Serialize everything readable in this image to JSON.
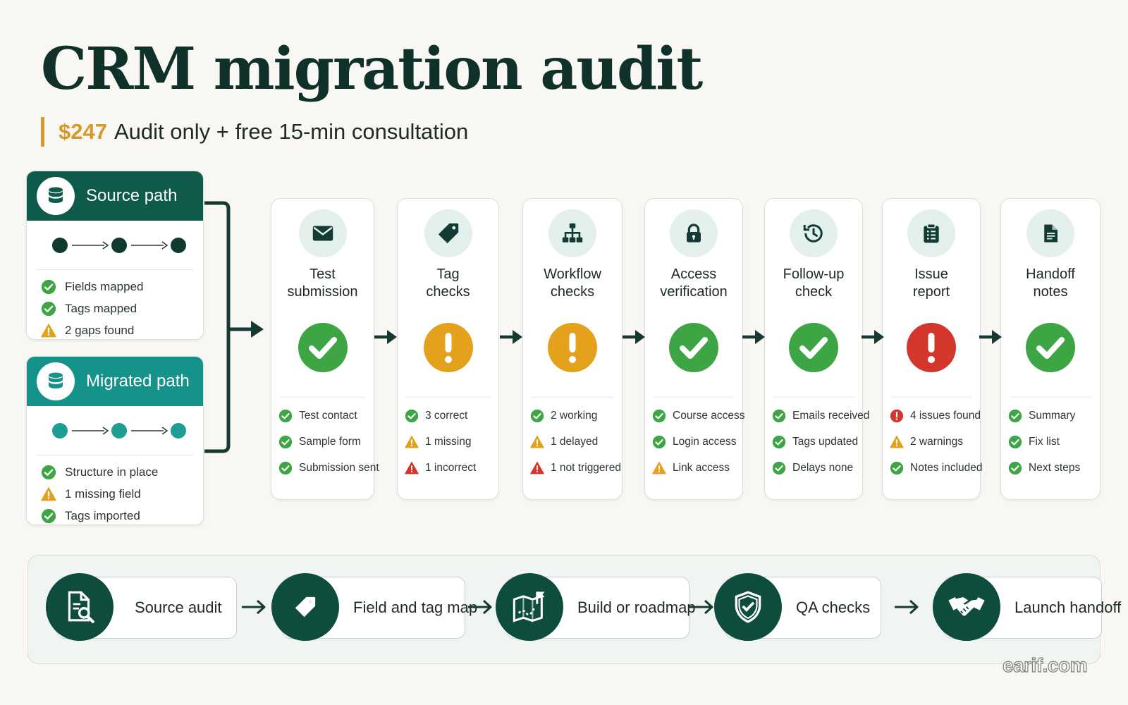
{
  "title": "CRM migration audit",
  "subtitle": {
    "price": "$247",
    "text": "Audit only + free 15-min consultation"
  },
  "colors": {
    "dark_green": "#0e4c3d",
    "teal": "#15928a",
    "gold": "#d49b2a",
    "ok_green": "#3da544",
    "warn_amber": "#e3a11c",
    "error_red": "#d3372b"
  },
  "panels": [
    {
      "title": "Source path",
      "icon": "database-icon",
      "color": "#0e5b4b",
      "node_color": "#103a30",
      "items": [
        {
          "status": "ok",
          "text": "Fields mapped"
        },
        {
          "status": "ok",
          "text": "Tags mapped"
        },
        {
          "status": "warn",
          "text": "2 gaps found"
        }
      ]
    },
    {
      "title": "Migrated path",
      "icon": "database-icon",
      "color": "#15928a",
      "node_color": "#1e9d94",
      "items": [
        {
          "status": "ok",
          "text": "Structure in place"
        },
        {
          "status": "warn",
          "text": "1 missing field"
        },
        {
          "status": "ok",
          "text": "Tags imported"
        }
      ]
    }
  ],
  "steps": [
    {
      "label": [
        "Test",
        "submission"
      ],
      "icon": "envelope-icon",
      "result": "ok",
      "items": [
        {
          "status": "ok",
          "text": "Test contact"
        },
        {
          "status": "ok",
          "text": "Sample form"
        },
        {
          "status": "ok",
          "text": "Submission sent"
        }
      ]
    },
    {
      "label": [
        "Tag",
        "checks"
      ],
      "icon": "tag-icon",
      "result": "warn",
      "items": [
        {
          "status": "ok",
          "text": "3 correct"
        },
        {
          "status": "warn",
          "text": "1 missing"
        },
        {
          "status": "error",
          "text": "1 incorrect"
        }
      ]
    },
    {
      "label": [
        "Workflow",
        "checks"
      ],
      "icon": "sitemap-icon",
      "result": "warn",
      "items": [
        {
          "status": "ok",
          "text": "2 working"
        },
        {
          "status": "warn",
          "text": "1 delayed"
        },
        {
          "status": "error",
          "text": "1 not triggered"
        }
      ]
    },
    {
      "label": [
        "Access",
        "verification"
      ],
      "icon": "lock-icon",
      "result": "ok",
      "items": [
        {
          "status": "ok",
          "text": "Course access"
        },
        {
          "status": "ok",
          "text": "Login access"
        },
        {
          "status": "warn",
          "text": "Link access"
        }
      ]
    },
    {
      "label": [
        "Follow-up",
        "check"
      ],
      "icon": "history-clock-icon",
      "result": "ok",
      "items": [
        {
          "status": "ok",
          "text": "Emails received"
        },
        {
          "status": "ok",
          "text": "Tags updated"
        },
        {
          "status": "ok",
          "text": "Delays none"
        }
      ]
    },
    {
      "label": [
        "Issue",
        "report"
      ],
      "icon": "clipboard-icon",
      "result": "error",
      "items": [
        {
          "status": "error-circle",
          "text": "4 issues found"
        },
        {
          "status": "warn",
          "text": "2 warnings"
        },
        {
          "status": "ok",
          "text": "Notes included"
        }
      ]
    },
    {
      "label": [
        "Handoff",
        "notes"
      ],
      "icon": "document-icon",
      "result": "ok",
      "items": [
        {
          "status": "ok",
          "text": "Summary"
        },
        {
          "status": "ok",
          "text": "Fix list"
        },
        {
          "status": "ok",
          "text": "Next steps"
        }
      ]
    }
  ],
  "process": [
    {
      "label": "Source audit",
      "icon": "document-search-icon"
    },
    {
      "label": "Field and tag map",
      "icon": "tag-icon"
    },
    {
      "label": "Build or roadmap",
      "icon": "map-flag-icon"
    },
    {
      "label": "QA checks",
      "icon": "shield-check-icon"
    },
    {
      "label": "Launch handoff",
      "icon": "handshake-icon"
    }
  ],
  "footer": "earif.com"
}
